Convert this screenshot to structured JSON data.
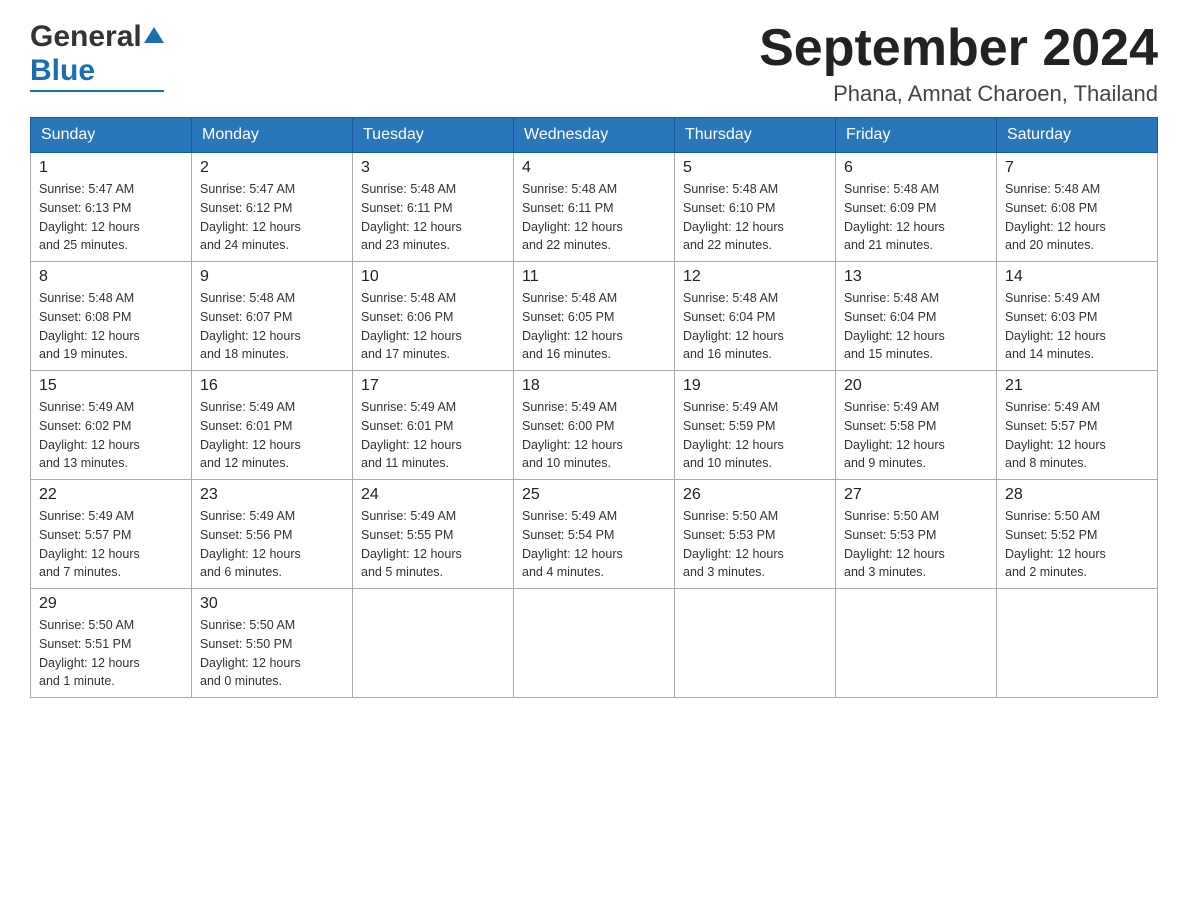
{
  "header": {
    "logo_general": "General",
    "logo_blue": "Blue",
    "main_title": "September 2024",
    "subtitle": "Phana, Amnat Charoen, Thailand"
  },
  "calendar": {
    "headers": [
      "Sunday",
      "Monday",
      "Tuesday",
      "Wednesday",
      "Thursday",
      "Friday",
      "Saturday"
    ],
    "weeks": [
      [
        {
          "day": "1",
          "sunrise": "5:47 AM",
          "sunset": "6:13 PM",
          "daylight": "12 hours and 25 minutes."
        },
        {
          "day": "2",
          "sunrise": "5:47 AM",
          "sunset": "6:12 PM",
          "daylight": "12 hours and 24 minutes."
        },
        {
          "day": "3",
          "sunrise": "5:48 AM",
          "sunset": "6:11 PM",
          "daylight": "12 hours and 23 minutes."
        },
        {
          "day": "4",
          "sunrise": "5:48 AM",
          "sunset": "6:11 PM",
          "daylight": "12 hours and 22 minutes."
        },
        {
          "day": "5",
          "sunrise": "5:48 AM",
          "sunset": "6:10 PM",
          "daylight": "12 hours and 22 minutes."
        },
        {
          "day": "6",
          "sunrise": "5:48 AM",
          "sunset": "6:09 PM",
          "daylight": "12 hours and 21 minutes."
        },
        {
          "day": "7",
          "sunrise": "5:48 AM",
          "sunset": "6:08 PM",
          "daylight": "12 hours and 20 minutes."
        }
      ],
      [
        {
          "day": "8",
          "sunrise": "5:48 AM",
          "sunset": "6:08 PM",
          "daylight": "12 hours and 19 minutes."
        },
        {
          "day": "9",
          "sunrise": "5:48 AM",
          "sunset": "6:07 PM",
          "daylight": "12 hours and 18 minutes."
        },
        {
          "day": "10",
          "sunrise": "5:48 AM",
          "sunset": "6:06 PM",
          "daylight": "12 hours and 17 minutes."
        },
        {
          "day": "11",
          "sunrise": "5:48 AM",
          "sunset": "6:05 PM",
          "daylight": "12 hours and 16 minutes."
        },
        {
          "day": "12",
          "sunrise": "5:48 AM",
          "sunset": "6:04 PM",
          "daylight": "12 hours and 16 minutes."
        },
        {
          "day": "13",
          "sunrise": "5:48 AM",
          "sunset": "6:04 PM",
          "daylight": "12 hours and 15 minutes."
        },
        {
          "day": "14",
          "sunrise": "5:49 AM",
          "sunset": "6:03 PM",
          "daylight": "12 hours and 14 minutes."
        }
      ],
      [
        {
          "day": "15",
          "sunrise": "5:49 AM",
          "sunset": "6:02 PM",
          "daylight": "12 hours and 13 minutes."
        },
        {
          "day": "16",
          "sunrise": "5:49 AM",
          "sunset": "6:01 PM",
          "daylight": "12 hours and 12 minutes."
        },
        {
          "day": "17",
          "sunrise": "5:49 AM",
          "sunset": "6:01 PM",
          "daylight": "12 hours and 11 minutes."
        },
        {
          "day": "18",
          "sunrise": "5:49 AM",
          "sunset": "6:00 PM",
          "daylight": "12 hours and 10 minutes."
        },
        {
          "day": "19",
          "sunrise": "5:49 AM",
          "sunset": "5:59 PM",
          "daylight": "12 hours and 10 minutes."
        },
        {
          "day": "20",
          "sunrise": "5:49 AM",
          "sunset": "5:58 PM",
          "daylight": "12 hours and 9 minutes."
        },
        {
          "day": "21",
          "sunrise": "5:49 AM",
          "sunset": "5:57 PM",
          "daylight": "12 hours and 8 minutes."
        }
      ],
      [
        {
          "day": "22",
          "sunrise": "5:49 AM",
          "sunset": "5:57 PM",
          "daylight": "12 hours and 7 minutes."
        },
        {
          "day": "23",
          "sunrise": "5:49 AM",
          "sunset": "5:56 PM",
          "daylight": "12 hours and 6 minutes."
        },
        {
          "day": "24",
          "sunrise": "5:49 AM",
          "sunset": "5:55 PM",
          "daylight": "12 hours and 5 minutes."
        },
        {
          "day": "25",
          "sunrise": "5:49 AM",
          "sunset": "5:54 PM",
          "daylight": "12 hours and 4 minutes."
        },
        {
          "day": "26",
          "sunrise": "5:50 AM",
          "sunset": "5:53 PM",
          "daylight": "12 hours and 3 minutes."
        },
        {
          "day": "27",
          "sunrise": "5:50 AM",
          "sunset": "5:53 PM",
          "daylight": "12 hours and 3 minutes."
        },
        {
          "day": "28",
          "sunrise": "5:50 AM",
          "sunset": "5:52 PM",
          "daylight": "12 hours and 2 minutes."
        }
      ],
      [
        {
          "day": "29",
          "sunrise": "5:50 AM",
          "sunset": "5:51 PM",
          "daylight": "12 hours and 1 minute."
        },
        {
          "day": "30",
          "sunrise": "5:50 AM",
          "sunset": "5:50 PM",
          "daylight": "12 hours and 0 minutes."
        },
        null,
        null,
        null,
        null,
        null
      ]
    ]
  }
}
